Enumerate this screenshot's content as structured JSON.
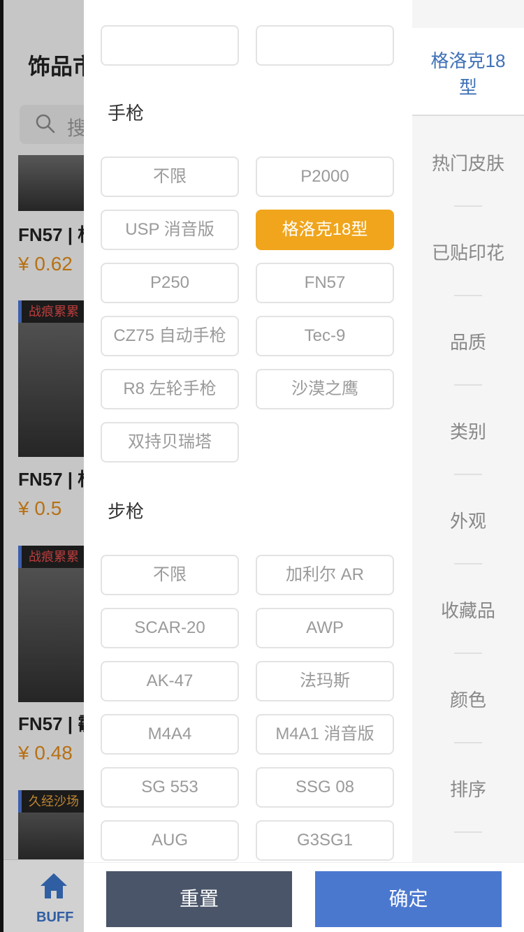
{
  "background": {
    "title": "饰品市",
    "search_placeholder": "搜",
    "items": [
      {
        "tag": "",
        "name": "FN57 | 柞",
        "price": "¥ 0.62"
      },
      {
        "tag": "战痕累累",
        "name": "FN57 | 柞",
        "price": "¥ 0.5"
      },
      {
        "tag": "战痕累累",
        "name": "FN57 | 霰",
        "price": "¥ 0.48"
      },
      {
        "tag": "久经沙场",
        "name": "",
        "price": ""
      }
    ],
    "tabbar": {
      "home_label": "BUFF"
    }
  },
  "filter": {
    "pistol": {
      "title": "手枪",
      "options": [
        "不限",
        "P2000",
        "USP 消音版",
        "格洛克18型",
        "P250",
        "FN57",
        "CZ75 自动手枪",
        "Tec-9",
        "R8 左轮手枪",
        "沙漠之鹰",
        "双持贝瑞塔"
      ],
      "selected": "格洛克18型"
    },
    "rifle": {
      "title": "步枪",
      "options": [
        "不限",
        "加利尔 AR",
        "SCAR-20",
        "AWP",
        "AK-47",
        "法玛斯",
        "M4A4",
        "M4A1 消音版",
        "SG 553",
        "SSG 08",
        "AUG",
        "G3SG1"
      ]
    }
  },
  "sidebar": {
    "active": "格洛克18型",
    "items": [
      "热门皮肤",
      "已贴印花",
      "品质",
      "类别",
      "外观",
      "收藏品",
      "颜色",
      "排序"
    ]
  },
  "actions": {
    "reset": "重置",
    "confirm": "确定"
  },
  "colors": {
    "accent_orange": "#f0a51c",
    "active_blue": "#3f71b7",
    "reset_bg": "#4a5569",
    "confirm_bg": "#4b78cf"
  }
}
